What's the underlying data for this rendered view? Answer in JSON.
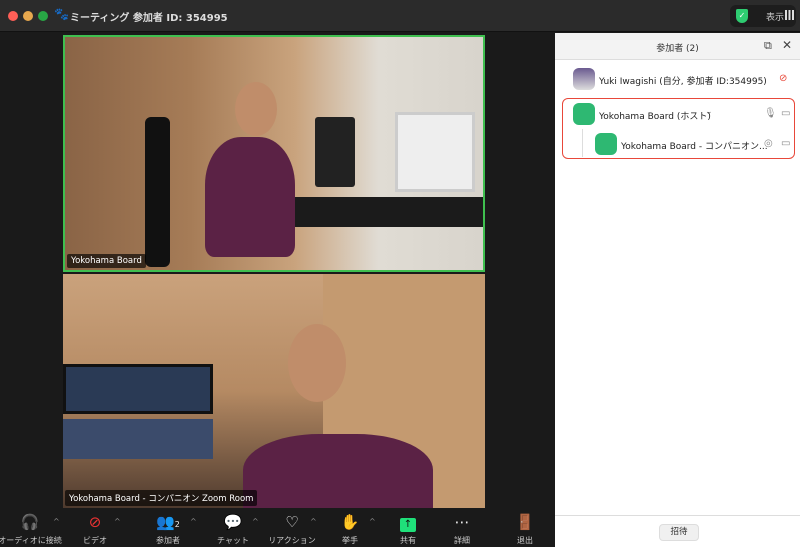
{
  "window": {
    "title": "ミーティング 参加者 ID: 354995",
    "view_label": "表示"
  },
  "videos": [
    {
      "name": "Yokohama Board",
      "active_speaker": true
    },
    {
      "name": "Yokohama Board - コンパニオン Zoom Room",
      "active_speaker": false
    }
  ],
  "toolbar": {
    "audio": "オーディオに接続",
    "video": "ビデオ",
    "participants": "参加者",
    "participants_count": "2",
    "chat": "チャット",
    "reactions": "リアクション",
    "raise_hand": "挙手",
    "share": "共有",
    "more": "詳細",
    "leave": "退出"
  },
  "panel": {
    "title": "参加者 (2)",
    "participants": [
      {
        "name": "Yuki Iwagishi (自分, 参加者 ID:354995)",
        "video_off": true
      },
      {
        "name": "Yokohama Board (ホスト)",
        "mic": true,
        "video": true
      },
      {
        "name": "Yokohama Board - コンパニオン...",
        "companion": true,
        "video": true
      }
    ],
    "invite": "招待"
  },
  "colors": {
    "accent_green": "#2ecc71",
    "highlight_red": "#e8483a",
    "share_green": "#1fe07a"
  }
}
